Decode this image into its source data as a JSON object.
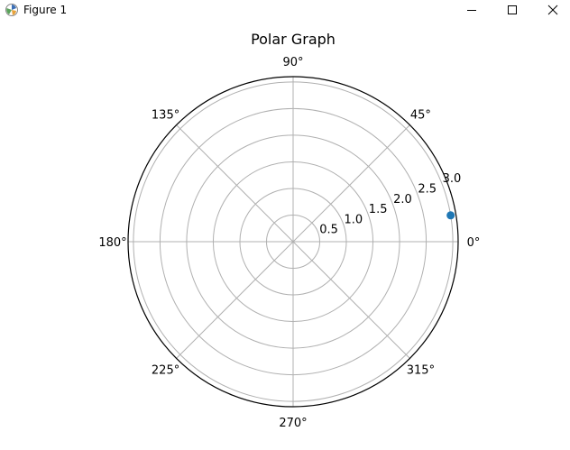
{
  "window": {
    "title": "Figure 1",
    "icons": {
      "app": "matplotlib-icon",
      "minimize": "minimize-icon",
      "maximize": "maximize-icon",
      "close": "close-icon"
    }
  },
  "chart_data": {
    "type": "scatter",
    "projection": "polar",
    "title": "Polar Graph",
    "theta_tick_labels": [
      "0°",
      "45°",
      "90°",
      "135°",
      "180°",
      "225°",
      "270°",
      "315°"
    ],
    "theta_ticks_deg": [
      0,
      45,
      90,
      135,
      180,
      225,
      270,
      315
    ],
    "r_tick_labels": [
      "0.5",
      "1.0",
      "1.5",
      "2.0",
      "2.5",
      "3.0"
    ],
    "r_ticks": [
      0.5,
      1.0,
      1.5,
      2.0,
      2.5,
      3.0
    ],
    "rlim": [
      0,
      3.1
    ],
    "r_label_angle_deg": 22.5,
    "grid": true,
    "points": [
      {
        "theta_deg": 9.5,
        "r": 3.0
      }
    ],
    "marker_color": "#1f77b4",
    "grid_color": "#b0b0b0",
    "spine_color": "#000000"
  }
}
